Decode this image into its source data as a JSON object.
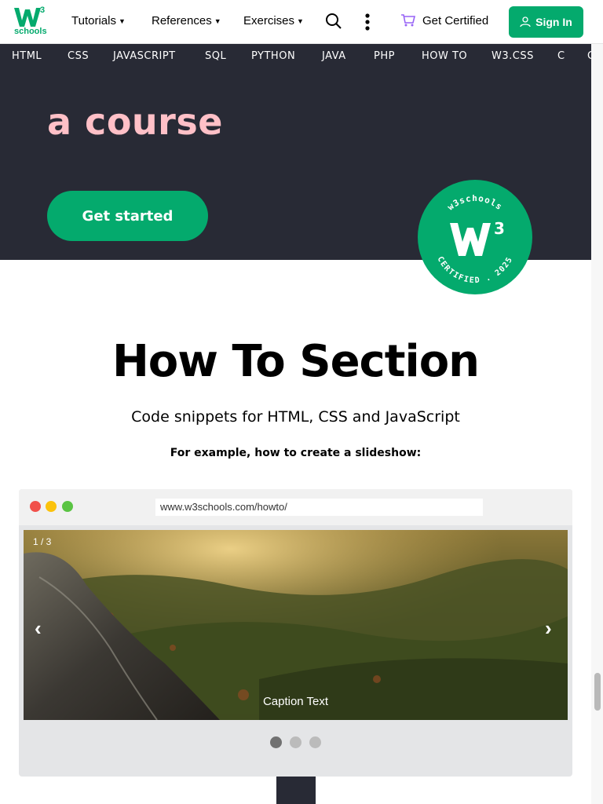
{
  "header": {
    "logo_text": "schools",
    "logo_letter": "W",
    "logo_sup": "3",
    "nav": [
      {
        "label": "Tutorials"
      },
      {
        "label": "References"
      },
      {
        "label": "Exercises"
      }
    ],
    "search_icon": "search-icon",
    "more_icon": "vertical-dots-icon",
    "get_certified": "Get Certified",
    "cart_icon": "cart-icon",
    "sign_in": "Sign In",
    "user_icon": "user-icon",
    "brand_color": "#04AA6D"
  },
  "subnav": {
    "items": [
      "HTML",
      "CSS",
      "JAVASCRIPT",
      "SQL",
      "PYTHON",
      "JAVA",
      "PHP",
      "HOW TO",
      "W3.CSS",
      "C"
    ]
  },
  "hero": {
    "title_fragment": "a course",
    "cta": "Get started",
    "title_color": "#FFC0C7",
    "background": "#282A35"
  },
  "badge": {
    "top_text": "w3schools",
    "bottom_text": "CERTIFIED . 2025",
    "letter": "W",
    "sup": "3"
  },
  "howto": {
    "title": "How To Section",
    "subtitle": "Code snippets for HTML, CSS and JavaScript",
    "example": "For example, how to create a slideshow:"
  },
  "browser": {
    "url": "www.w3schools.com/howto/",
    "dot_colors": [
      "#f1514b",
      "#fbc20c",
      "#5ac443"
    ]
  },
  "slideshow": {
    "counter": "1 / 3",
    "caption": "Caption Text",
    "prev": "‹",
    "next": "›",
    "dots": [
      {
        "active": true
      },
      {
        "active": false
      },
      {
        "active": false
      }
    ]
  }
}
